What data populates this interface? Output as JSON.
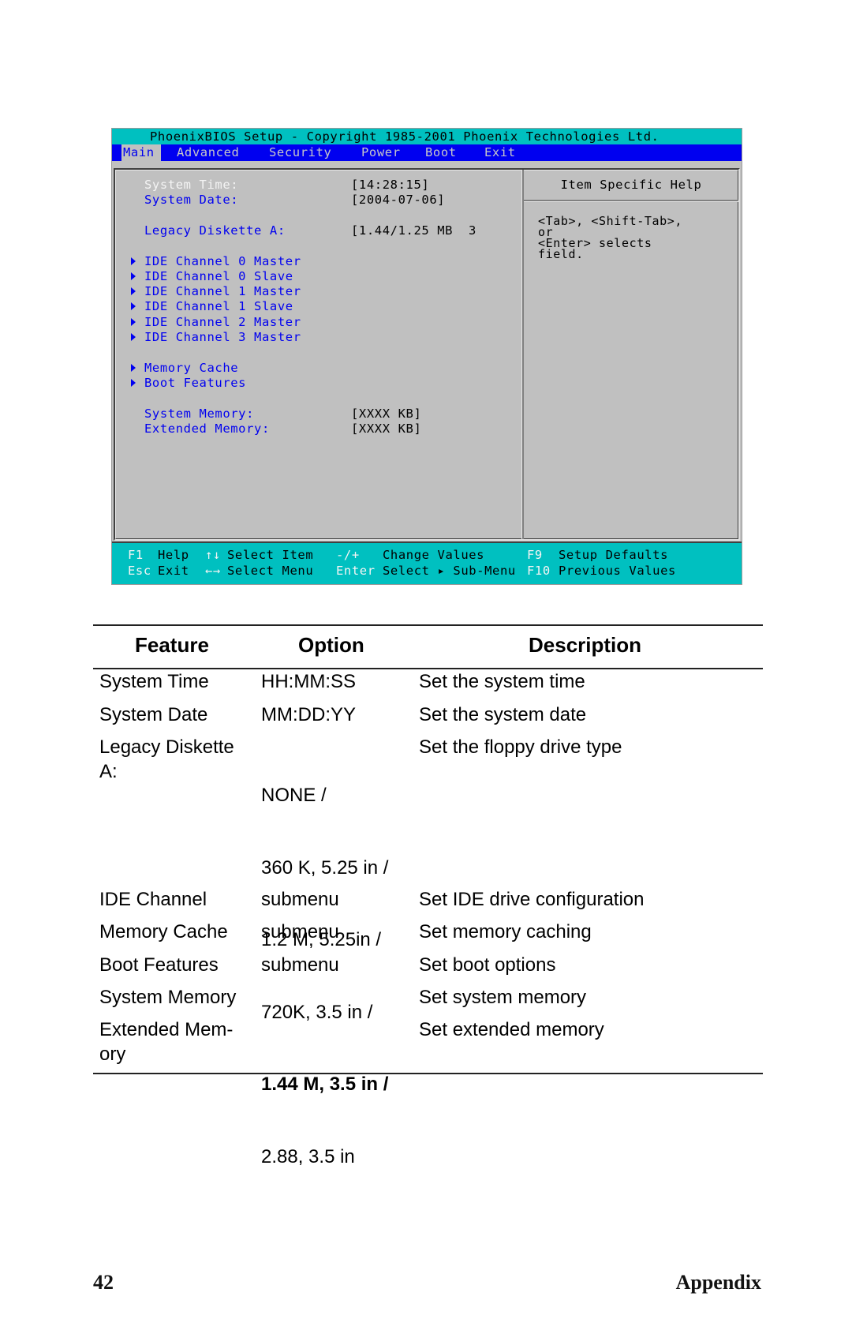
{
  "bios": {
    "title": "PhoenixBIOS Setup - Copyright 1985-2001 Phoenix Technologies Ltd.",
    "menu": [
      "Main",
      "Advanced",
      "Security",
      "Power",
      "Boot",
      "Exit"
    ],
    "active_menu": "Main",
    "fields": {
      "system_time_label": "System Time:",
      "system_time_value": "[14:28:15]",
      "system_date_label": "System Date:",
      "system_date_value": "[2004-07-06]",
      "legacy_diskette_label": "Legacy Diskette A:",
      "legacy_diskette_value": "[1.44/1.25 MB  3",
      "submenus": [
        "IDE Channel 0 Master",
        "IDE Channel 0 Slave",
        "IDE Channel 1 Master",
        "IDE Channel 1 Slave",
        "IDE Channel 2 Master",
        "IDE Channel 3 Master",
        "Memory Cache",
        "Boot Features"
      ],
      "system_memory_label": "System Memory:",
      "system_memory_value": "[XXXX KB]",
      "extended_memory_label": "Extended Memory:",
      "extended_memory_value": "[XXXX KB]"
    },
    "help": {
      "title": "Item Specific Help",
      "text": "<Tab>, <Shift-Tab>,\nor\n<Enter> selects\nfield."
    },
    "footer": {
      "row1": [
        {
          "key": "F1",
          "desc": "Help"
        },
        {
          "key": "↑↓",
          "desc": "Select Item"
        },
        {
          "key": "-/+",
          "desc": "Change Values"
        },
        {
          "key": "F9",
          "desc": "Setup Defaults"
        }
      ],
      "row2": [
        {
          "key": "Esc",
          "desc": "Exit"
        },
        {
          "key": "←→",
          "desc": "Select Menu"
        },
        {
          "key": "Enter",
          "desc": "Select ▸ Sub-Menu"
        },
        {
          "key": "F10",
          "desc": "Previous Values"
        }
      ]
    }
  },
  "table": {
    "headers": [
      "Feature",
      "Option",
      "Description"
    ],
    "rows": [
      {
        "feature": "System Time",
        "option": "HH:MM:SS",
        "description": "Set the system time"
      },
      {
        "feature": "System Date",
        "option": "MM:DD:YY",
        "description": "Set the system date"
      },
      {
        "feature": "Legacy Diskette\nA:",
        "option_lines": [
          "NONE /",
          "360 K, 5.25 in /",
          "1.2 M, 5.25in /",
          "720K, 3.5 in /",
          "1.44 M, 3.5 in /",
          "2.88, 3.5 in"
        ],
        "option_default": "1.44 M, 3.5 in /",
        "description": "Set the floppy drive type"
      },
      {
        "feature": "IDE Channel",
        "option": "submenu",
        "description": "Set IDE drive configuration"
      },
      {
        "feature": "Memory Cache",
        "option": "submenu",
        "description": "Set memory caching"
      },
      {
        "feature": "Boot Features",
        "option": "submenu",
        "description": "Set boot options"
      },
      {
        "feature": "System Memory",
        "option": "",
        "description": "Set system memory"
      },
      {
        "feature": "Extended Mem-\nory",
        "option": "",
        "description": "Set extended memory"
      }
    ]
  },
  "page": {
    "number": "42",
    "section": "Appendix"
  }
}
